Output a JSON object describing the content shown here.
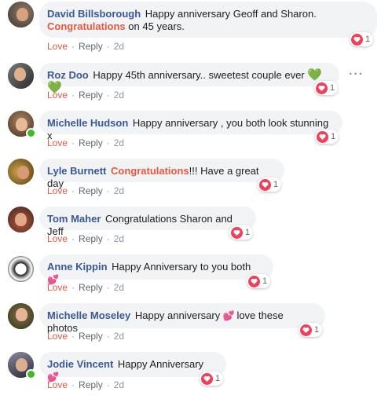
{
  "actions": {
    "love": "Love",
    "reply": "Reply",
    "dot": "·"
  },
  "colors": {
    "author": "#385898",
    "highlight": "#e9573f",
    "heart": "#f33e58",
    "bubble": "#f2f3f5"
  },
  "comments": [
    {
      "author": "David Billsborough",
      "text_before": "Happy anniversary Geoff and Sharon.",
      "highlight": "Congratulations",
      "text_after": "on 45 years.",
      "time": "2d",
      "reaction_count": "1"
    },
    {
      "author": "Roz Doo",
      "text": "Happy 45th anniversary.. sweetest couple ever",
      "emoji": "💚💚",
      "time": "2d",
      "reaction_count": "1",
      "more": "···"
    },
    {
      "author": "Michelle Hudson",
      "text": "Happy anniversary , you both look stunning x",
      "time": "2d",
      "reaction_count": "1"
    },
    {
      "author": "Lyle Burnett",
      "highlight": "Congratulations",
      "text_after": "!!! Have a great day",
      "time": "2d",
      "reaction_count": "1"
    },
    {
      "author": "Tom Maher",
      "text": "Congratulations Sharon and Jeff",
      "time": "2d",
      "reaction_count": "1"
    },
    {
      "author": "Anne Kippin",
      "text": "Happy Anniversary to you both",
      "emoji": "💕",
      "time": "2d",
      "reaction_count": "1"
    },
    {
      "author": "Michelle Moseley",
      "text": "Happy anniversary",
      "emoji": "💕",
      "text_after": "love these photos",
      "time": "2d",
      "reaction_count": "1"
    },
    {
      "author": "Jodie Vincent",
      "text": "Happy Anniversary",
      "emoji": "💕",
      "time": "2d",
      "reaction_count": "1"
    }
  ]
}
